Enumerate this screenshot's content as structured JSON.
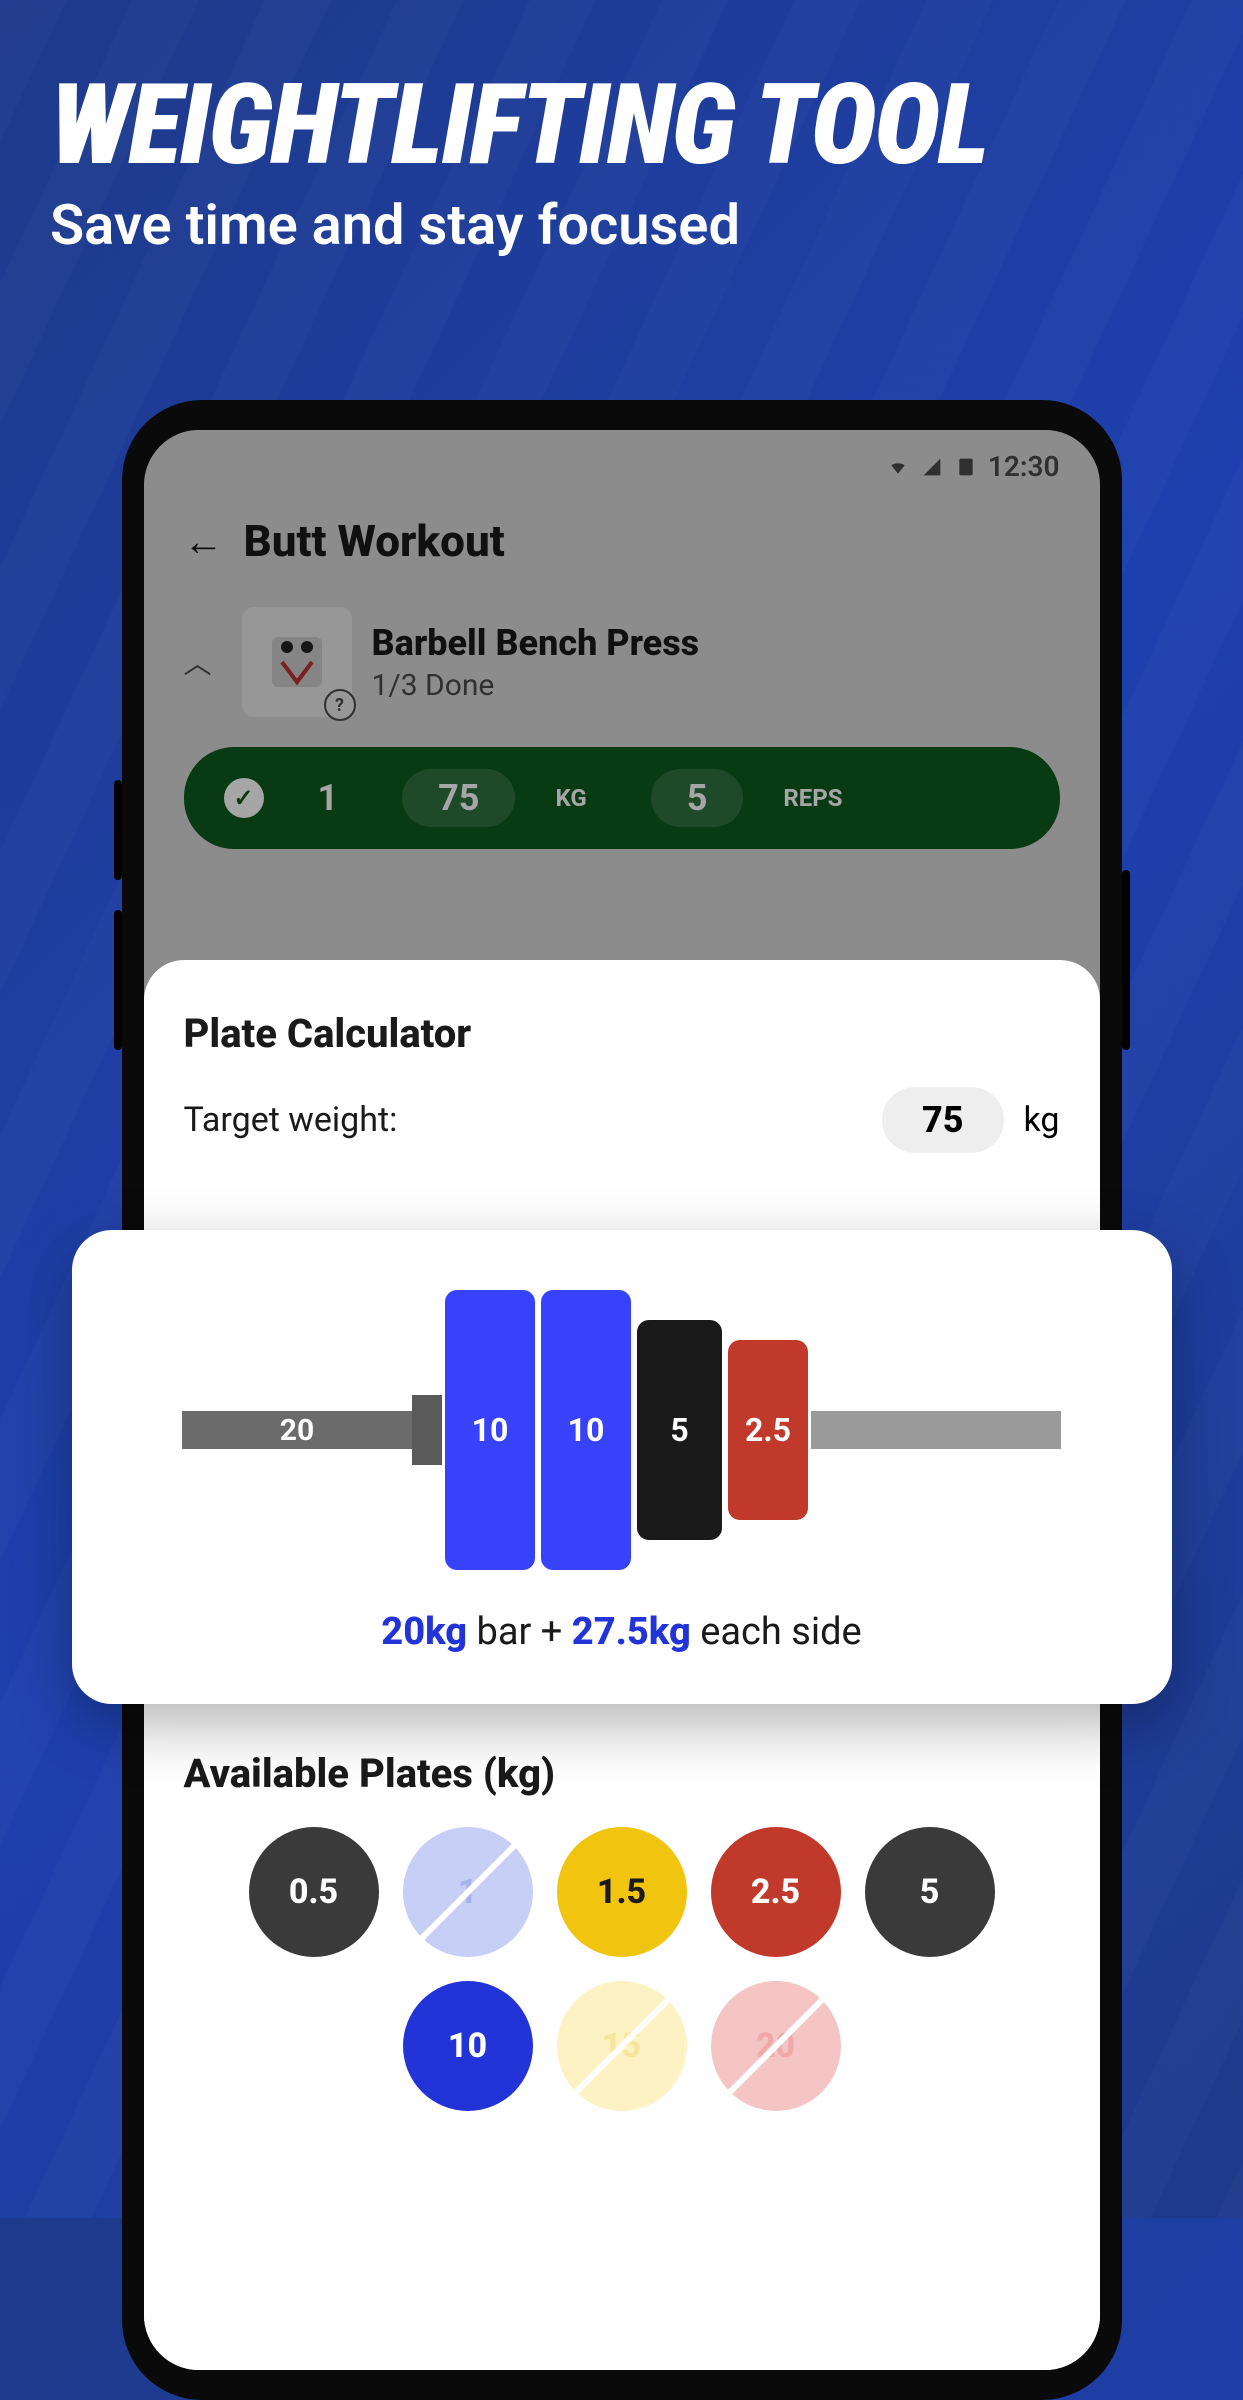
{
  "hero": {
    "title": "WEIGHTLIFTING TOOL",
    "subtitle": "Save time and stay focused"
  },
  "status": {
    "time": "12:30"
  },
  "header": {
    "title": "Butt Workout"
  },
  "exercise": {
    "name": "Barbell Bench Press",
    "progress": "1/3 Done"
  },
  "set": {
    "number": "1",
    "weight": "75",
    "weight_unit": "KG",
    "reps": "5",
    "reps_unit": "REPS"
  },
  "calculator": {
    "title": "Plate Calculator",
    "target_label": "Target weight:",
    "target_value": "75",
    "target_unit": "kg"
  },
  "viz": {
    "bar_weight": "20",
    "plates": [
      {
        "label": "10",
        "color": "#3742fa"
      },
      {
        "label": "10",
        "color": "#3742fa"
      },
      {
        "label": "5",
        "color": "#1a1a1a"
      },
      {
        "label": "2.5",
        "color": "#c0392b"
      }
    ],
    "summary_bar": "20kg",
    "summary_mid": " bar + ",
    "summary_side": "27.5kg",
    "summary_end": " each side"
  },
  "available": {
    "title": "Available Plates (kg)",
    "plates": [
      {
        "label": "0.5",
        "enabled": true
      },
      {
        "label": "1",
        "enabled": false
      },
      {
        "label": "1.5",
        "enabled": true
      },
      {
        "label": "2.5",
        "enabled": true
      },
      {
        "label": "5",
        "enabled": true
      },
      {
        "label": "10",
        "enabled": true
      },
      {
        "label": "15",
        "enabled": false
      },
      {
        "label": "20",
        "enabled": false
      }
    ]
  }
}
